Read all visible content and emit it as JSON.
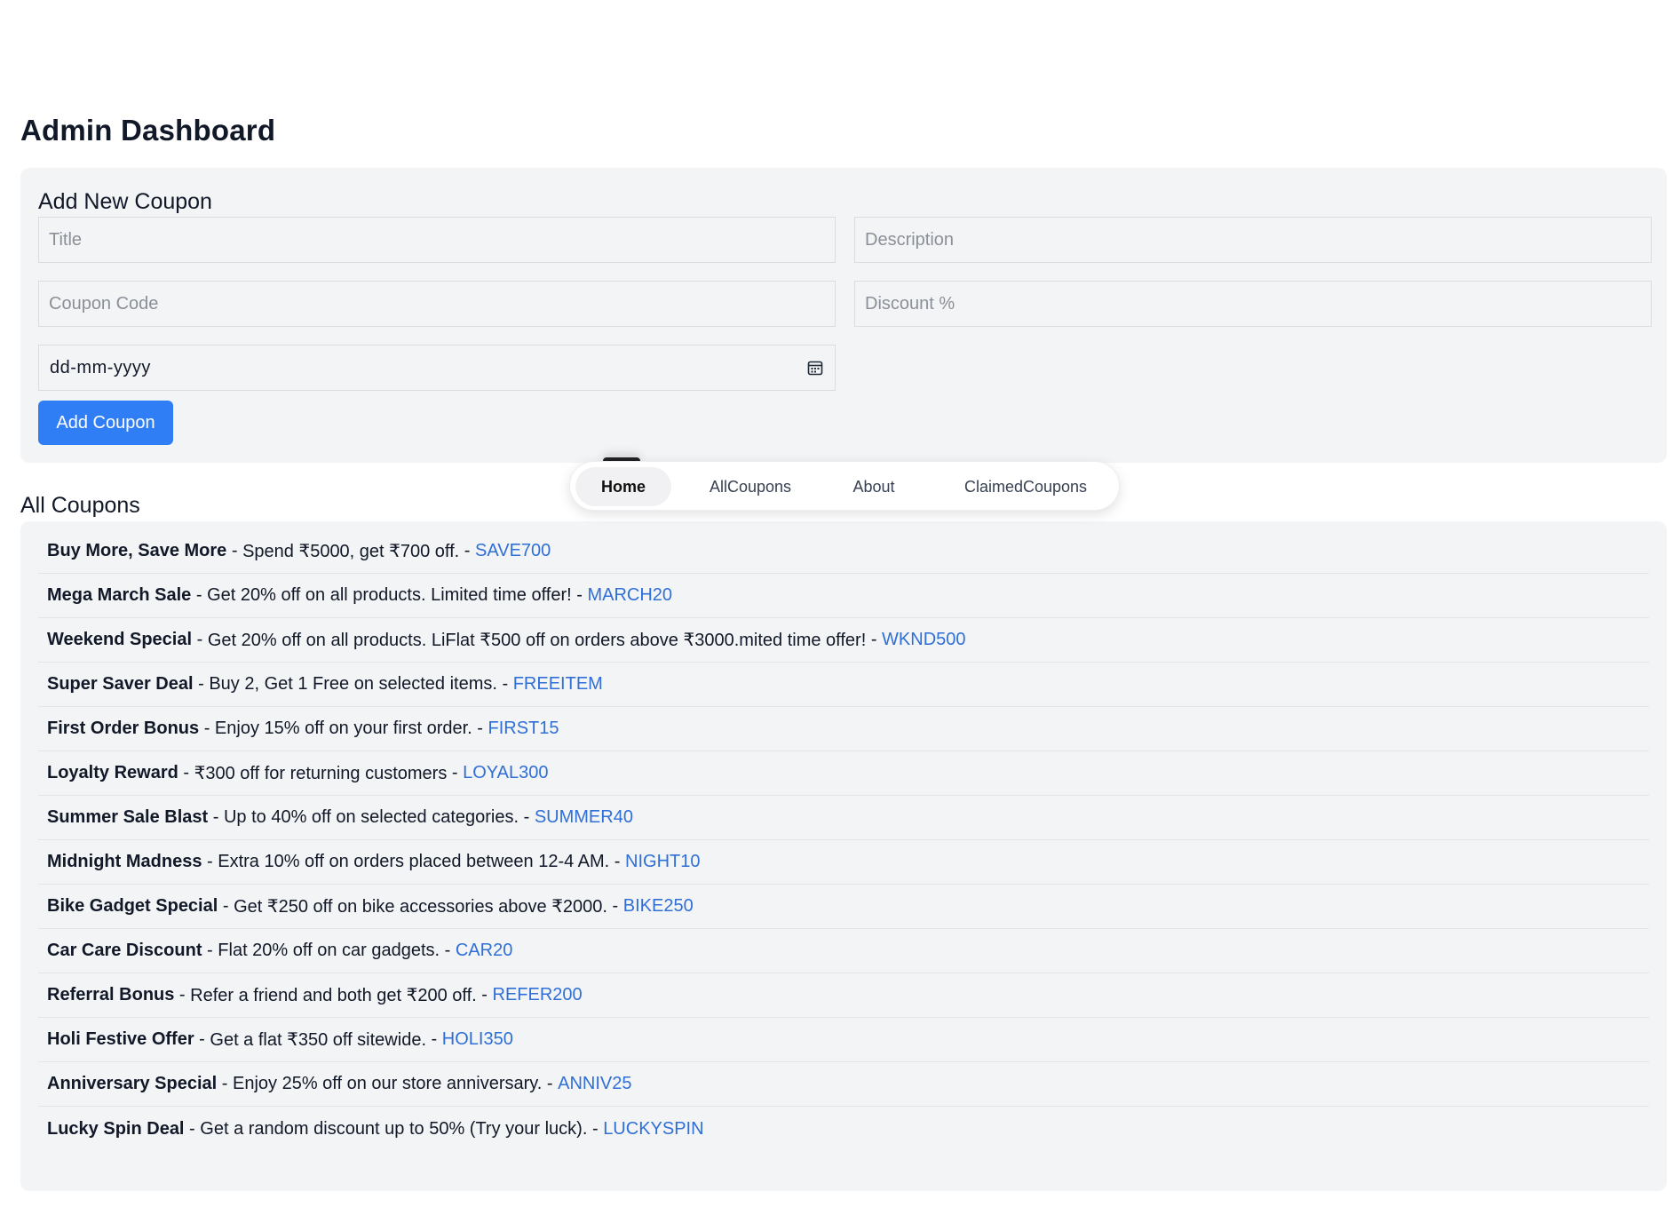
{
  "page": {
    "title": "Admin Dashboard"
  },
  "add_form": {
    "heading": "Add New Coupon",
    "title_placeholder": "Title",
    "description_placeholder": "Description",
    "code_placeholder": "Coupon Code",
    "discount_placeholder": "Discount %",
    "date_placeholder": "dd-mm-yyyy",
    "date_icon": "calendar-icon",
    "submit_label": "Add Coupon"
  },
  "coupons": {
    "heading": "All Coupons",
    "separator": " - ",
    "items": [
      {
        "title": "Buy More, Save More",
        "description": "Spend ₹5000, get ₹700 off.",
        "code": "SAVE700"
      },
      {
        "title": "Mega March Sale",
        "description": "Get 20% off on all products. Limited time offer!",
        "code": "MARCH20"
      },
      {
        "title": "Weekend Special",
        "description": "Get 20% off on all products. LiFlat ₹500 off on orders above ₹3000.mited time offer!",
        "code": "WKND500"
      },
      {
        "title": "Super Saver Deal",
        "description": "Buy 2, Get 1 Free on selected items.",
        "code": "FREEITEM"
      },
      {
        "title": "First Order Bonus",
        "description": "Enjoy 15% off on your first order.",
        "code": "FIRST15"
      },
      {
        "title": "Loyalty Reward",
        "description": "₹300 off for returning customers",
        "code": "LOYAL300"
      },
      {
        "title": "Summer Sale Blast",
        "description": "Up to 40% off on selected categories.",
        "code": "SUMMER40"
      },
      {
        "title": "Midnight Madness",
        "description": "Extra 10% off on orders placed between 12-4 AM.",
        "code": "NIGHT10"
      },
      {
        "title": "Bike Gadget Special",
        "description": "Get ₹250 off on bike accessories above ₹2000.",
        "code": "BIKE250"
      },
      {
        "title": "Car Care Discount",
        "description": "Flat 20% off on car gadgets.",
        "code": "CAR20"
      },
      {
        "title": "Referral Bonus",
        "description": "Refer a friend and both get ₹200 off.",
        "code": "REFER200"
      },
      {
        "title": "Holi Festive Offer",
        "description": "Get a flat ₹350 off sitewide.",
        "code": "HOLI350"
      },
      {
        "title": "Anniversary Special",
        "description": "Enjoy 25% off on our store anniversary.",
        "code": "ANNIV25"
      },
      {
        "title": "Lucky Spin Deal",
        "description": "Get a random discount up to 50% (Try your luck).",
        "code": "LUCKYSPIN"
      }
    ]
  },
  "nav": {
    "active": "Home",
    "items": [
      "Home",
      "AllCoupons",
      "About",
      "ClaimedCoupons"
    ]
  },
  "colors": {
    "primary_button": "#2f7ef5",
    "code_link": "#2f6fd6",
    "panel_background": "#f3f4f6"
  }
}
